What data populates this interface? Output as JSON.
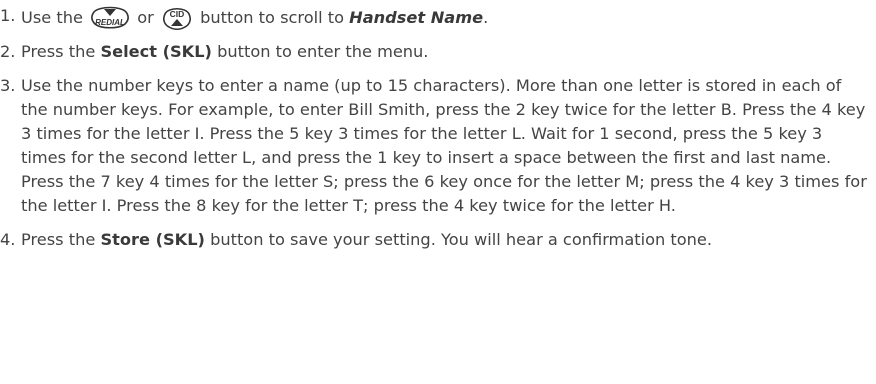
{
  "steps": [
    {
      "number": "1.",
      "parts": {
        "t1": "Use the",
        "icon1": "REDIAL",
        "t2": "or",
        "icon2": "CID",
        "t3": "button to scroll to",
        "bold": "Handset Name",
        "t4": "."
      }
    },
    {
      "number": "2.",
      "parts": {
        "t1": "Press the",
        "bold": "Select (SKL)",
        "t2": "button to enter the menu."
      }
    },
    {
      "number": "3.",
      "text": "Use the number keys to enter a name (up to 15 characters). More than one letter is stored in each of the number keys. For example, to enter Bill Smith, press the 2 key twice for the letter B. Press the 4 key 3 times for the letter I. Press the 5 key 3 times for the letter L. Wait for 1 second, press the 5 key 3 times for the second letter L, and press the 1 key to insert a space between the first and last name. Press the 7 key 4 times for the letter S; press the 6 key once for the letter M; press the 4 key 3 times for the letter I. Press the 8 key for the letter T; press the 4 key twice for the letter H."
    },
    {
      "number": "4.",
      "parts": {
        "t1": "Press the",
        "bold": "Store (SKL)",
        "t2": "button to save your setting. You will hear a confirmation tone."
      }
    }
  ],
  "icons": {
    "redial": "redial-down-button-icon",
    "cid": "cid-up-button-icon"
  },
  "colors": {
    "text": "#444444",
    "icon_stroke": "#333333"
  }
}
